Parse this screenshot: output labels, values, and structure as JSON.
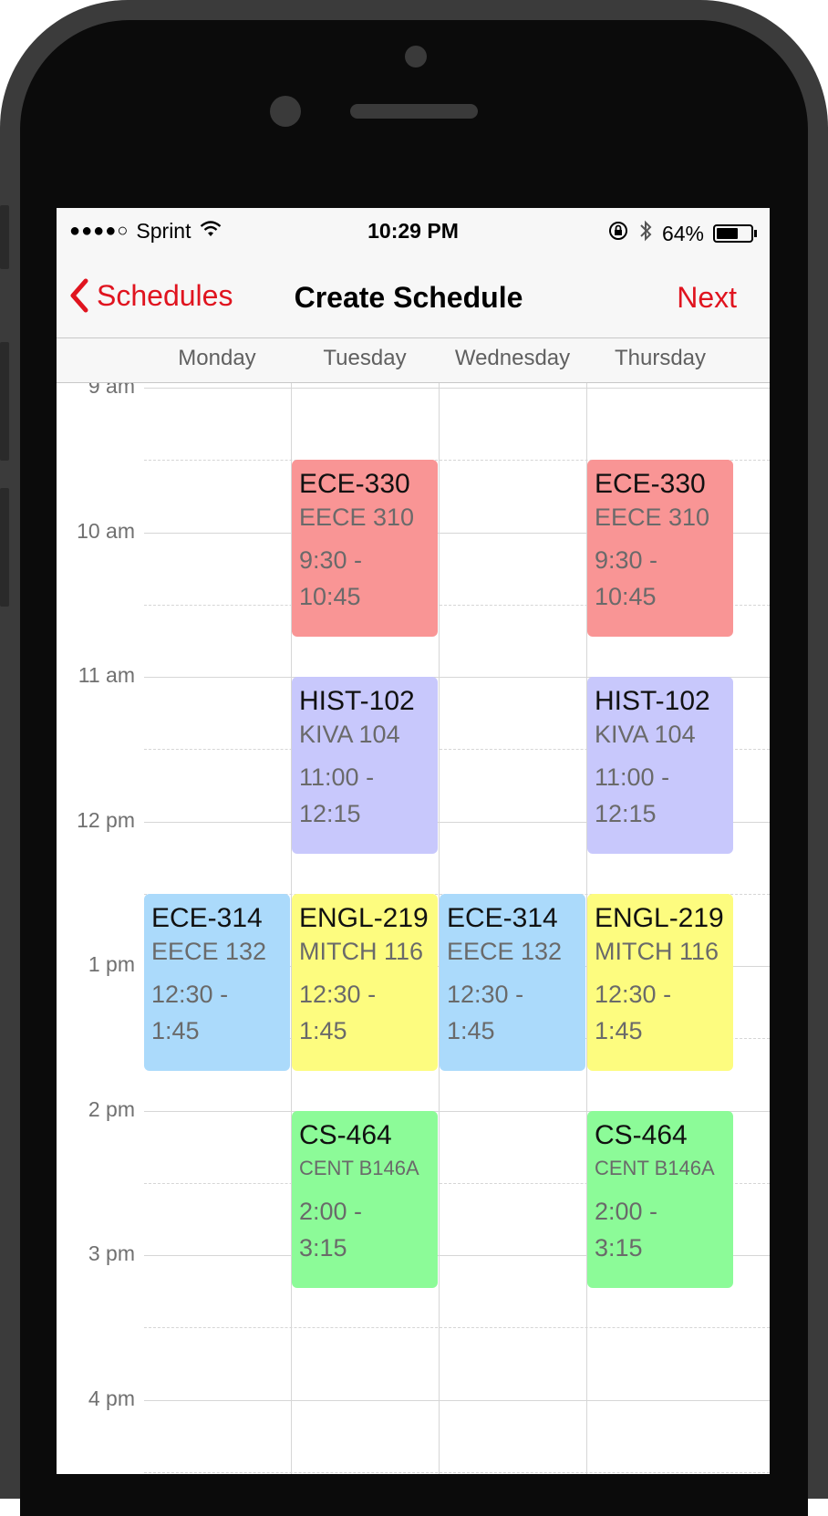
{
  "status_bar": {
    "signal": "●●●●○",
    "carrier": "Sprint",
    "time": "10:29 PM",
    "battery_percent": "64%",
    "battery_level": 0.64,
    "icons": [
      "wifi-icon",
      "rotation-lock-icon",
      "bluetooth-icon",
      "battery-icon"
    ]
  },
  "nav": {
    "back_label": "Schedules",
    "title": "Create Schedule",
    "next_label": "Next"
  },
  "days": [
    "Monday",
    "Tuesday",
    "Wednesday",
    "Thursday"
  ],
  "hours": [
    "9 am",
    "10 am",
    "11 am",
    "12 pm",
    "1 pm",
    "2 pm",
    "3 pm",
    "4 pm"
  ],
  "colors": {
    "accent": "#e0141f",
    "ECE-330": "#f99595",
    "HIST-102": "#c8c8fc",
    "ECE-314": "#abdafb",
    "ENGL-219": "#fdfc7f",
    "CS-464": "#8cfb98"
  },
  "classes": [
    {
      "code": "ECE-330",
      "room": "EECE 310",
      "time": "9:30 - 10:45",
      "days": [
        "Tuesday",
        "Thursday"
      ]
    },
    {
      "code": "HIST-102",
      "room": "KIVA 104",
      "time": "11:00 - 12:15",
      "days": [
        "Tuesday",
        "Thursday"
      ]
    },
    {
      "code": "ECE-314",
      "room": "EECE 132",
      "time": "12:30 - 1:45",
      "days": [
        "Monday",
        "Wednesday"
      ]
    },
    {
      "code": "ENGL-219",
      "room": "MITCH 116",
      "time": "12:30 - 1:45",
      "days": [
        "Tuesday",
        "Thursday"
      ]
    },
    {
      "code": "CS-464",
      "room": "CENT B146A",
      "time": "2:00 - 3:15",
      "days": [
        "Tuesday",
        "Thursday"
      ]
    }
  ]
}
